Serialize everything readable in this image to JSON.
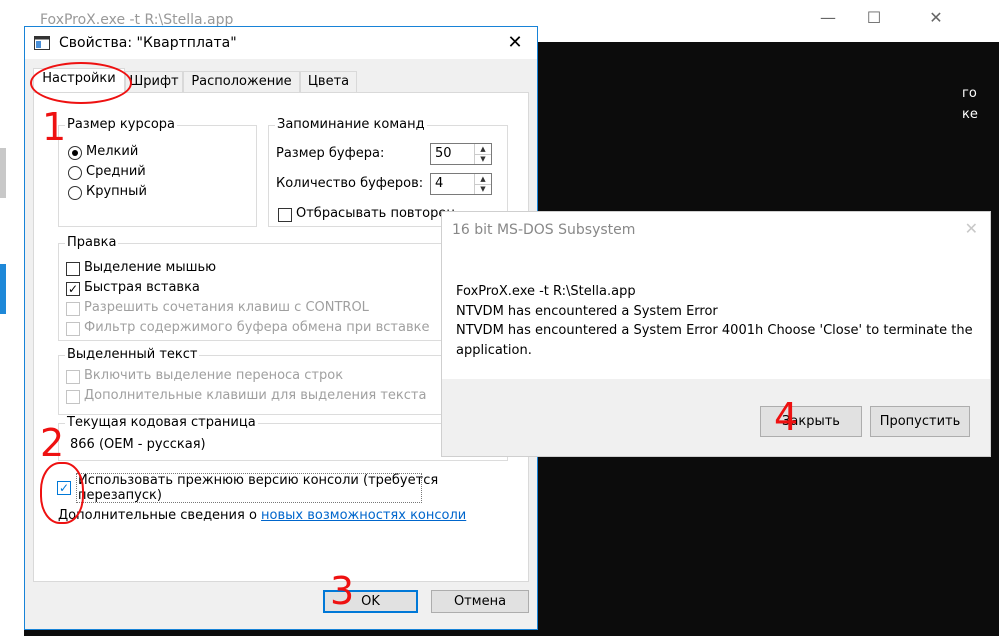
{
  "background_window": {
    "title": "FoxProX.exe  -t R:\\Stella.app",
    "controls": {
      "minimize": "—",
      "maximize": "☐",
      "close": "✕"
    },
    "right_edge_fragments": [
      "го",
      "ке"
    ]
  },
  "properties_dialog": {
    "title": "Свойства: \"Квартплата\"",
    "tabs": [
      "Настройки",
      "Шрифт",
      "Расположение",
      "Цвета"
    ],
    "active_tab": "Настройки",
    "cursor_size": {
      "title": "Размер курсора",
      "options": [
        "Мелкий",
        "Средний",
        "Крупный"
      ],
      "selected": "Мелкий"
    },
    "command_history": {
      "title": "Запоминание команд",
      "buffer_size_label": "Размер буфера:",
      "buffer_size_value": "50",
      "buffer_count_label": "Количество буферов:",
      "buffer_count_value": "4",
      "discard_label": "Отбрасывать повторен"
    },
    "edit_options": {
      "title": "Правка",
      "items": [
        {
          "label": "Выделение мышью",
          "checked": false,
          "enabled": true
        },
        {
          "label": "Быстрая вставка",
          "checked": true,
          "enabled": true
        },
        {
          "label": "Разрешить сочетания клавиш с CONTROL",
          "checked": false,
          "enabled": false
        },
        {
          "label": "Фильтр содержимого буфера обмена при вставке",
          "checked": false,
          "enabled": false
        }
      ]
    },
    "text_selection": {
      "title": "Выделенный текст",
      "items": [
        {
          "label": "Включить выделение переноса строк",
          "checked": false,
          "enabled": false
        },
        {
          "label": "Дополнительные клавиши для выделения текста",
          "checked": false,
          "enabled": false
        }
      ]
    },
    "codepage": {
      "title": "Текущая кодовая страница",
      "value": "866  (OEM - русская)"
    },
    "legacy_console": {
      "label_line1": "Использовать прежнюю версию консоли (требуется",
      "label_line2": "перезапуск)",
      "checked": true
    },
    "more_info": {
      "prefix": "Дополнительные сведения о ",
      "link": "новых возможностях консоли"
    },
    "ok_label": "OK",
    "cancel_label": "Отмена"
  },
  "msdos_dialog": {
    "title": "16 bit MS-DOS Subsystem",
    "lines": [
      "FoxProX.exe  -t R:\\Stella.app",
      "NTVDM has encountered a System Error",
      "NTVDM has encountered a System Error 4001h Choose 'Close' to terminate the",
      "application."
    ],
    "close_label": "Закрыть",
    "skip_label": "Пропустить",
    "close_glyph": "✕"
  },
  "annotations": {
    "numbers": [
      "1",
      "2",
      "3",
      "4"
    ],
    "color": "#e11111"
  },
  "colors": {
    "accent": "#0078d7",
    "link": "#0066cc",
    "dialog_bg": "#f0f0f0",
    "console_bg": "#0c0c0c"
  }
}
